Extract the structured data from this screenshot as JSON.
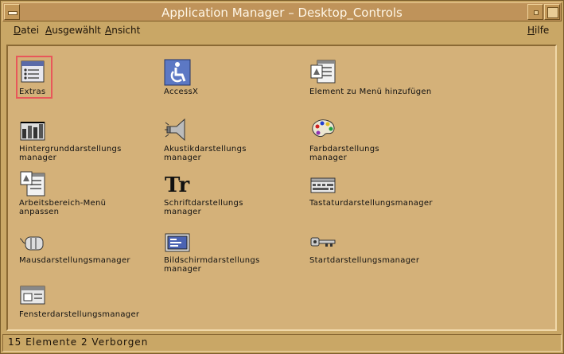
{
  "window": {
    "title": "Application Manager – Desktop_Controls",
    "controls": {
      "menu": "window-menu",
      "minimize": "minimize",
      "maximize": "maximize"
    }
  },
  "menubar": {
    "datei": {
      "mnemonic": "D",
      "rest": "atei"
    },
    "ausgewaehlt": {
      "mnemonic": "A",
      "rest": "usgewählt"
    },
    "ansicht": {
      "mnemonic": "A",
      "rest": "nsicht"
    },
    "hilfe": {
      "mnemonic": "H",
      "rest": "ilfe"
    }
  },
  "items": [
    {
      "label": "Extras",
      "icon": "extras-icon",
      "selected": true
    },
    {
      "label": "AccessX",
      "icon": "accessibility-icon"
    },
    {
      "label": "Element zu Menü hinzufügen",
      "icon": "add-to-menu-icon"
    },
    {
      "label": "Hintergrunddarstellungs\nmanager",
      "icon": "backdrop-icon"
    },
    {
      "label": "Akustikdarstellungs\nmanager",
      "icon": "speaker-icon"
    },
    {
      "label": "Farbdarstellungs\nmanager",
      "icon": "palette-icon"
    },
    {
      "label": "Arbeitsbereich-Menü\nanpassen",
      "icon": "workspace-menu-icon"
    },
    {
      "label": "Schriftdarstellungs\nmanager",
      "icon": "font-icon"
    },
    {
      "label": "Tastaturdarstellungsmanager",
      "icon": "keyboard-icon"
    },
    {
      "label": "Mausdarstellungsmanager",
      "icon": "mouse-icon"
    },
    {
      "label": "Bildschirmdarstellungs\nmanager",
      "icon": "screen-icon"
    },
    {
      "label": "Startdarstellungsmanager",
      "icon": "key-icon"
    },
    {
      "label": "Fensterdarstellungsmanager",
      "icon": "window-icon"
    }
  ],
  "status": {
    "text": "15 Elemente 2 Verborgen"
  },
  "colors": {
    "background": "#d4b179",
    "selection": "#e8575a",
    "title_text": "#fff6e6"
  }
}
